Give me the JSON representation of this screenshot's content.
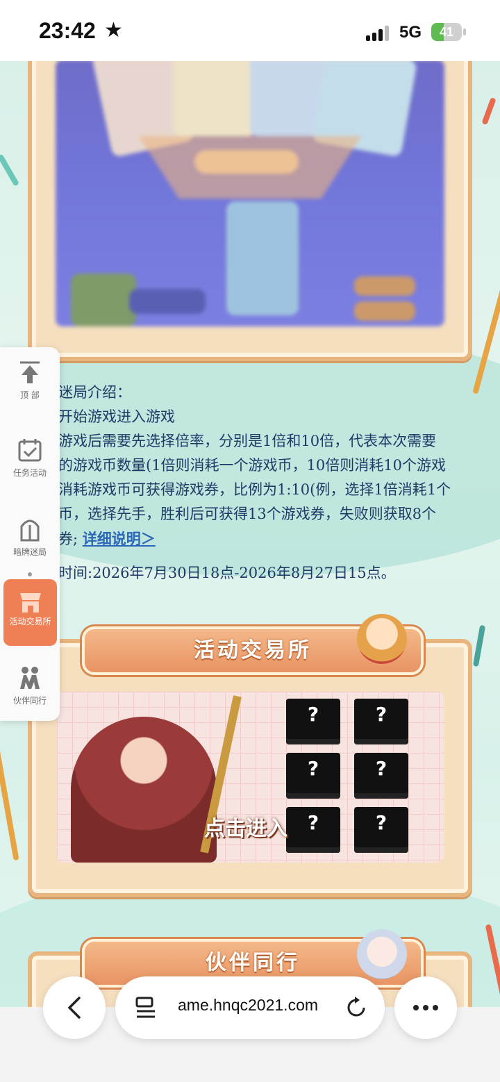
{
  "status_bar": {
    "time": "23:42",
    "star_glyph": "★",
    "network": "5G",
    "battery_percent": 41,
    "battery_label": "41"
  },
  "side_nav": {
    "items": [
      {
        "label": "顶 部",
        "icon": "arrow-up-to-top-icon"
      },
      {
        "label": "任务活动",
        "icon": "calendar-check-icon"
      },
      {
        "label": "暗牌迷局",
        "icon": "gate-icon"
      },
      {
        "label": "活动交易所",
        "icon": "shop-icon",
        "active": true
      },
      {
        "label": "伙伴同行",
        "icon": "partners-icon"
      }
    ]
  },
  "intro": {
    "line1": "迷局介绍：",
    "line2": "开始游戏进入游戏",
    "line3": "游戏后需要先选择倍率，分别是1倍和10倍，代表本次需要",
    "line4": "的游戏币数量(1倍则消耗一个游戏币，10倍则消耗10个游戏",
    "line5": "消耗游戏币可获得游戏券，比例为1:10(例，选择1倍消耗1个",
    "line6": "币，选择先手，胜利后可获得13个游戏券，失败则获取8个",
    "line7_prefix": "券;",
    "detail_link": "详细说明＞",
    "date_line": "时间:2026年7月30日18点-2026年8月27日15点。"
  },
  "exchange_section": {
    "title": "活动交易所",
    "enter_label": "点击进入",
    "mystery_glyph": "?"
  },
  "partner_section": {
    "title": "伙伴同行"
  },
  "browser": {
    "url": "ame.hnqc2021.com",
    "back_glyph": "‹",
    "more_glyph": "•••"
  },
  "colors": {
    "accent": "#ef7f54",
    "frame": "#e8b57f",
    "intro_text": "#1f3a66",
    "link": "#2c66b8"
  }
}
